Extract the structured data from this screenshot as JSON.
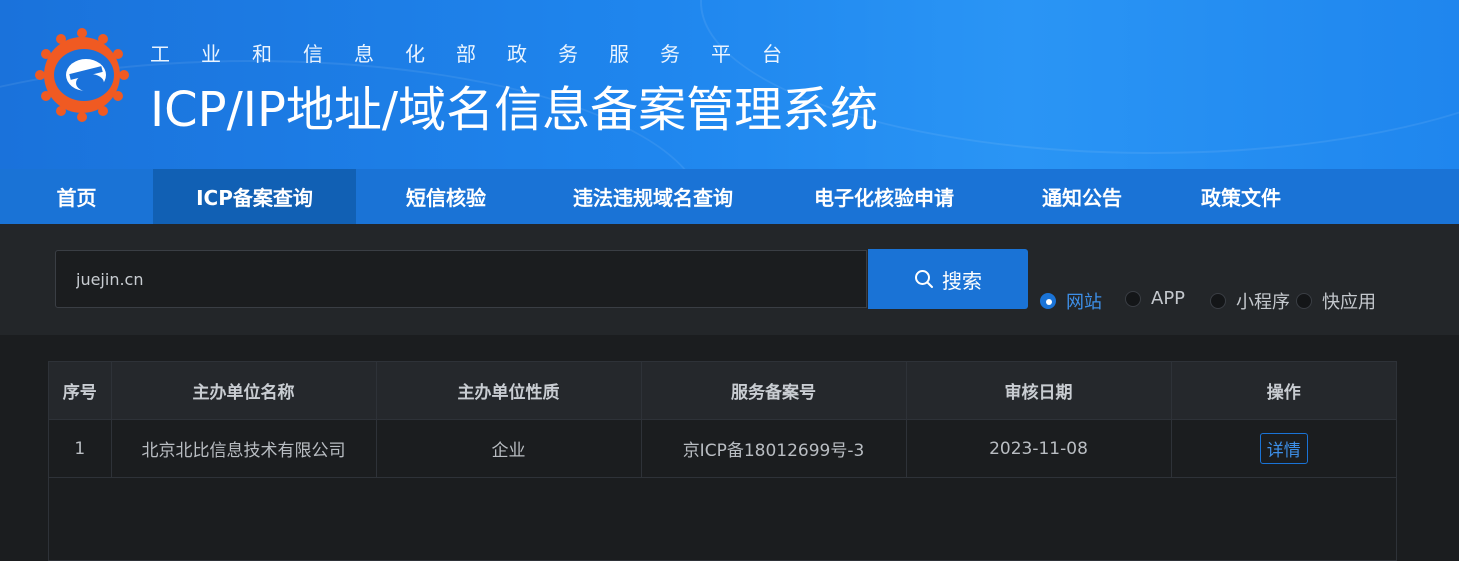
{
  "header": {
    "subtitle": "工业和信息化部政务服务平台",
    "title": "ICP/IP地址/域名信息备案管理系统"
  },
  "nav": {
    "items": [
      {
        "label": "首页",
        "active": false
      },
      {
        "label": "ICP备案查询",
        "active": true
      },
      {
        "label": "短信核验",
        "active": false
      },
      {
        "label": "违法违规域名查询",
        "active": false
      },
      {
        "label": "电子化核验申请",
        "active": false
      },
      {
        "label": "通知公告",
        "active": false
      },
      {
        "label": "政策文件",
        "active": false
      }
    ]
  },
  "search": {
    "value": "juejin.cn",
    "button_label": "搜索",
    "button_icon": "search-icon",
    "types": [
      {
        "label": "网站",
        "checked": true
      },
      {
        "label": "APP",
        "checked": false
      },
      {
        "label": "小程序",
        "checked": false
      },
      {
        "label": "快应用",
        "checked": false
      }
    ]
  },
  "table": {
    "headers": [
      "序号",
      "主办单位名称",
      "主办单位性质",
      "服务备案号",
      "审核日期",
      "操作"
    ],
    "rows": [
      {
        "index": "1",
        "org_name": "北京北比信息技术有限公司",
        "org_type": "企业",
        "record_no": "京ICP备18012699号-3",
        "date": "2023-11-08",
        "action": "详情"
      }
    ]
  },
  "colors": {
    "accent": "#1a73d6",
    "header_gradient_start": "#1a72db",
    "header_gradient_end": "#2a95f5",
    "logo_orange": "#f05a22",
    "background": "#1b1d1f"
  }
}
